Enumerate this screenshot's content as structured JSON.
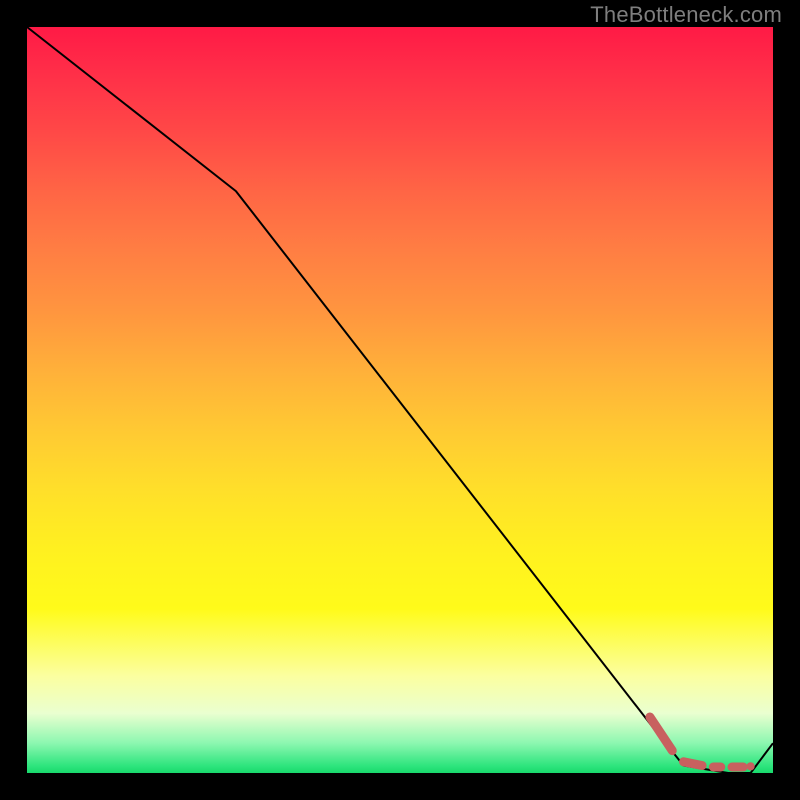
{
  "watermark": "TheBottleneck.com",
  "colors": {
    "background": "#000000",
    "curve": "#000000",
    "marker": "#c8605f"
  },
  "chart_data": {
    "type": "line",
    "title": "",
    "xlabel": "",
    "ylabel": "",
    "xlim": [
      0,
      100
    ],
    "ylim": [
      0,
      100
    ],
    "grid": false,
    "legend": false,
    "x": [
      0,
      28,
      84,
      88,
      94,
      97,
      100
    ],
    "values": [
      100,
      78,
      6,
      1,
      0,
      0,
      4
    ],
    "note": "Values are read off the plot area as percentages of its width (x) and height (y, 0 at bottom). The curve descends from top-left, has a slope break near x≈28, reaches a flat minimum around x≈88–97, then rises slightly at the right edge.",
    "markers": {
      "shape": "rounded-dash",
      "color_hex": "#c8605f",
      "segments": [
        {
          "x0": 83.5,
          "y0": 7.5,
          "x1": 86.5,
          "y1": 3.0
        },
        {
          "x0": 88.0,
          "y0": 1.5,
          "x1": 90.5,
          "y1": 1.0
        },
        {
          "x0": 92.0,
          "y0": 0.8,
          "x1": 93.0,
          "y1": 0.8
        },
        {
          "x0": 94.5,
          "y0": 0.8,
          "x1": 96.0,
          "y1": 0.8
        }
      ],
      "end_dot": {
        "x": 97.0,
        "y": 0.9,
        "r_pct": 0.55
      }
    }
  }
}
